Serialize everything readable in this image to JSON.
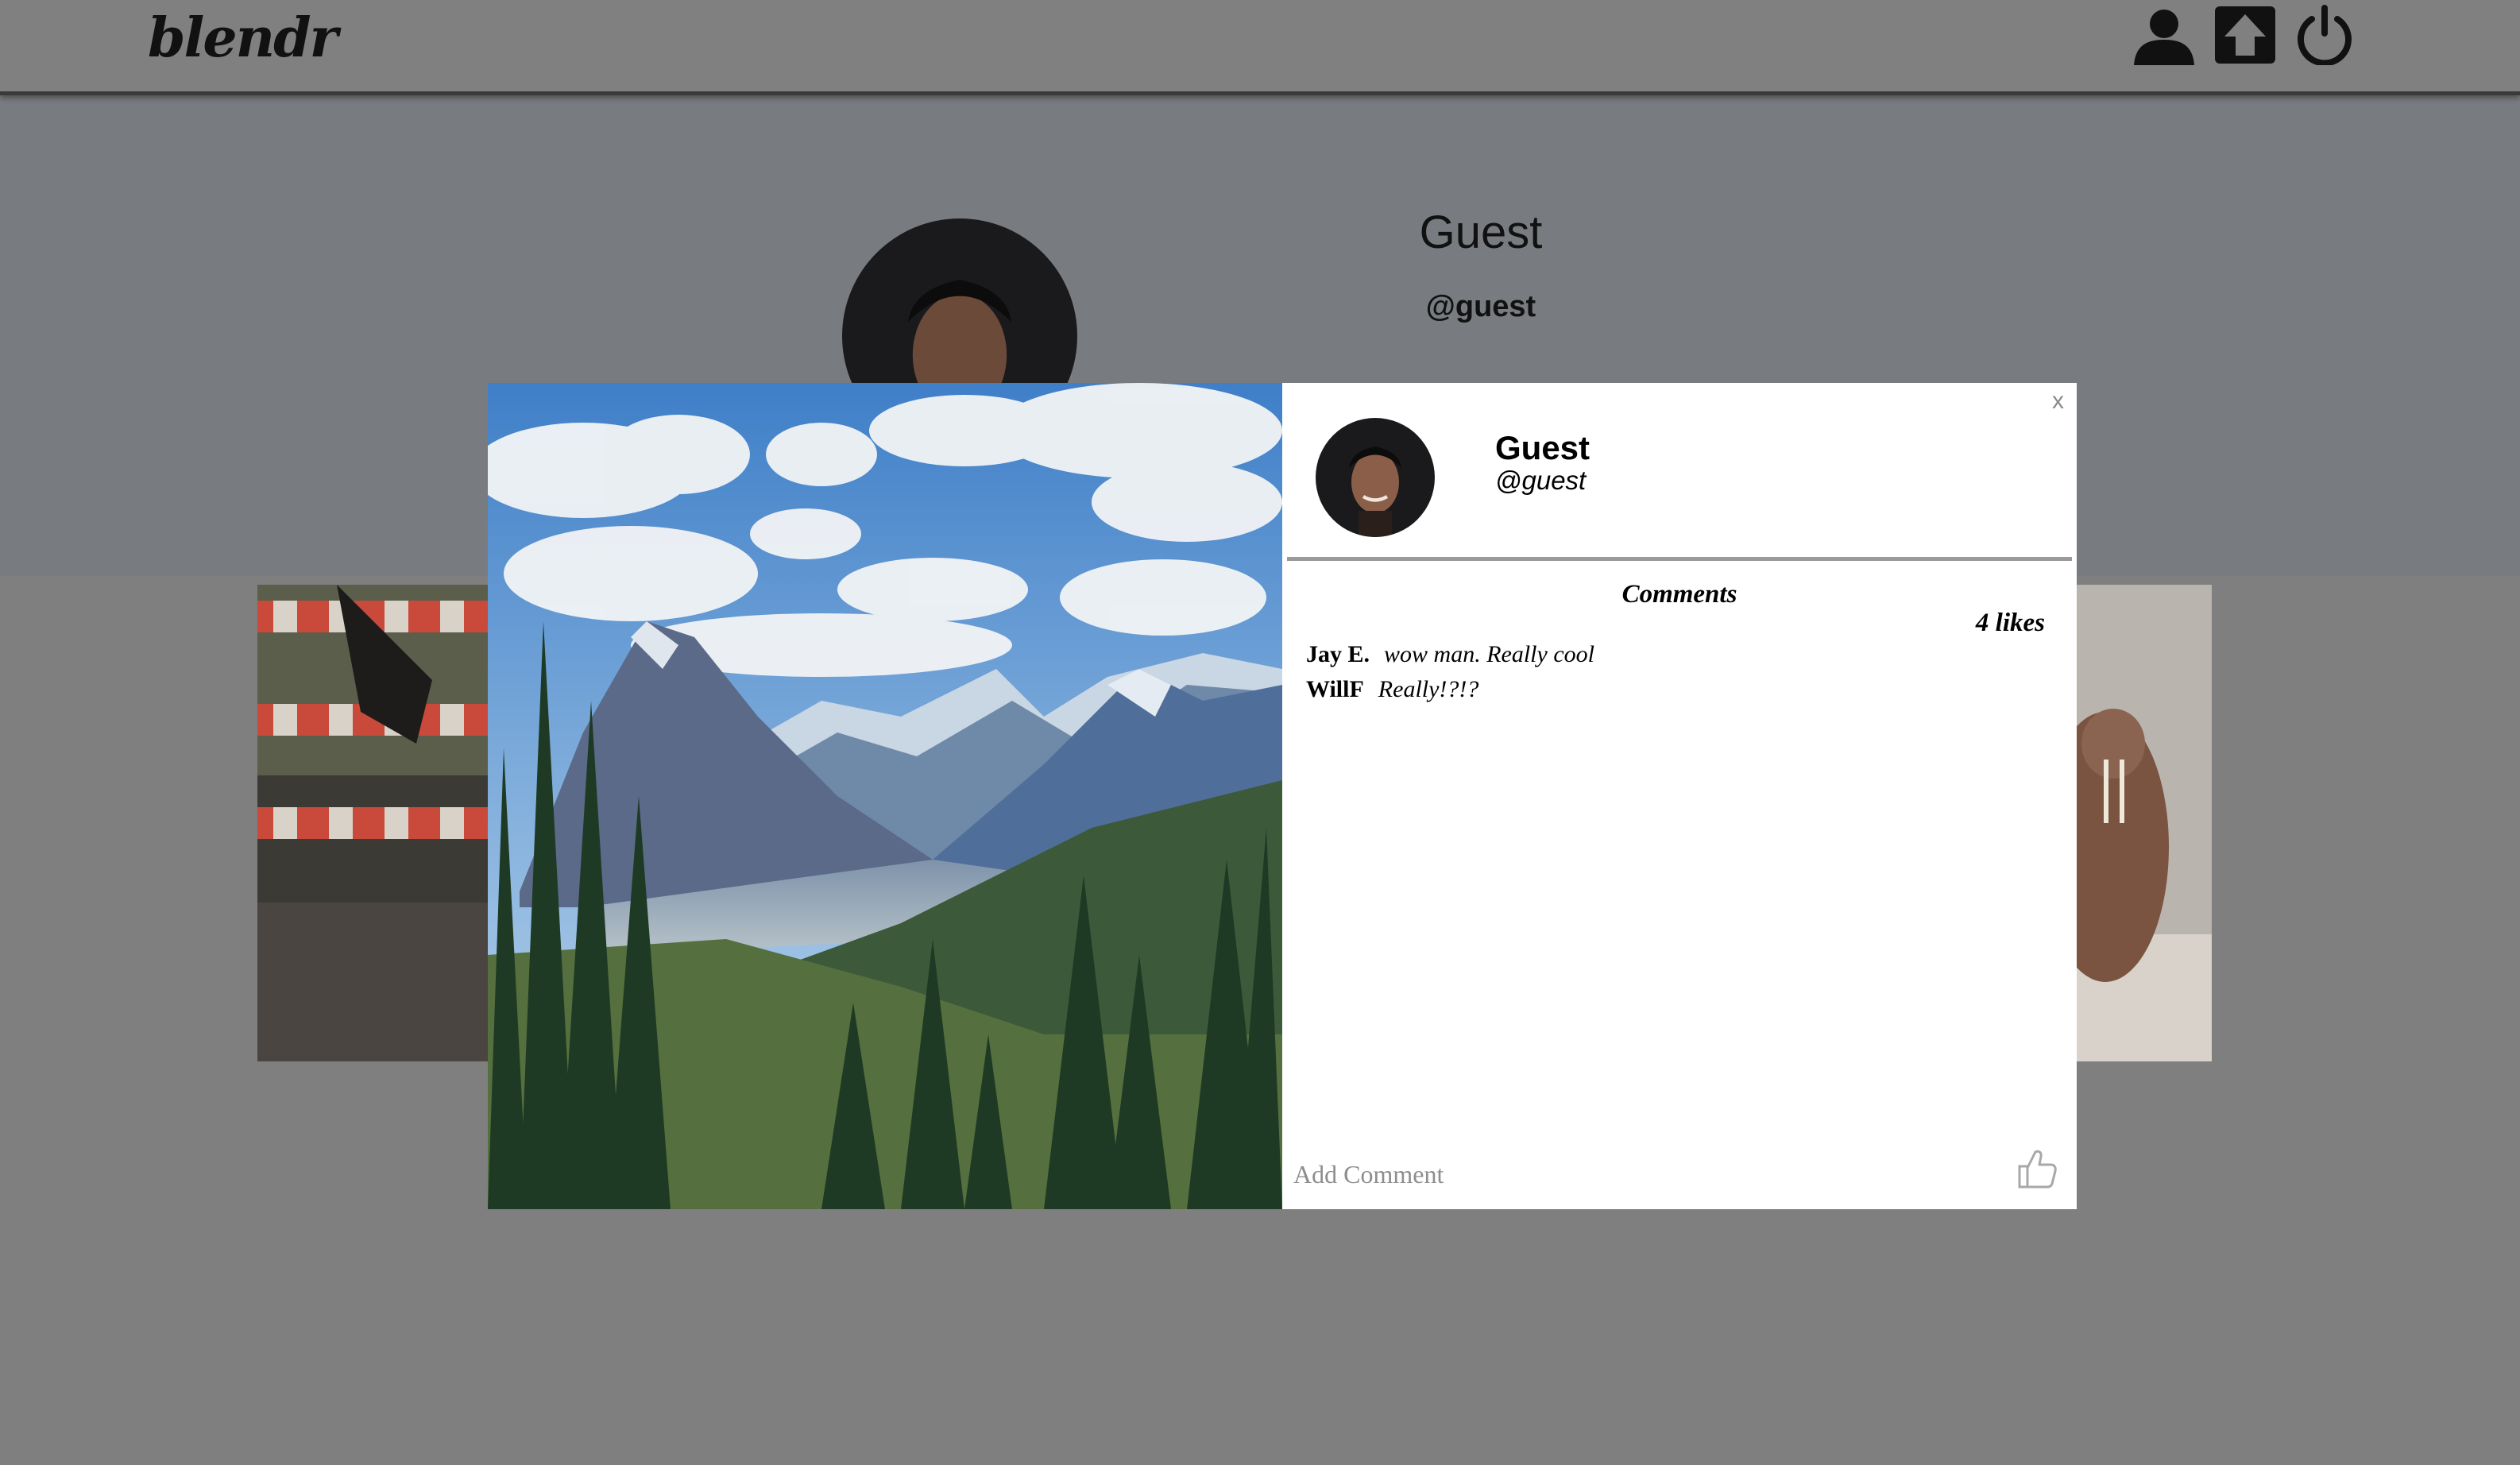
{
  "app": {
    "logo_text": "blendr"
  },
  "nav": {
    "profile_icon": "user-icon",
    "upload_icon": "upload-icon",
    "logout_icon": "power-icon"
  },
  "profile": {
    "name": "Guest",
    "handle": "@guest"
  },
  "modal": {
    "close_label": "x",
    "user": {
      "name": "Guest",
      "handle": "@guest"
    },
    "comments_title": "Comments",
    "likes": "4 likes",
    "comments": [
      {
        "user": "Jay E.",
        "text": "wow man. Really cool"
      },
      {
        "user": "WillF",
        "text": "Really!?!?"
      }
    ],
    "add_comment_placeholder": "Add Comment",
    "like_icon": "thumbs-up-icon"
  },
  "colors": {
    "overlay": "#7f7f7f",
    "profile_band": "#787c80",
    "modal_bg": "#ffffff",
    "divider": "#9a9a9a"
  }
}
